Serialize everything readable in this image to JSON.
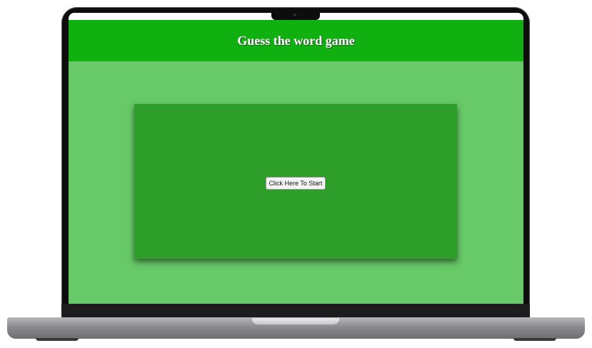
{
  "header": {
    "title": "Guess the word game"
  },
  "game": {
    "start_button_label": "Click Here To Start"
  },
  "colors": {
    "header_bg": "#0fb010",
    "page_bg": "#67c967",
    "card_bg": "#2e9e2b"
  }
}
